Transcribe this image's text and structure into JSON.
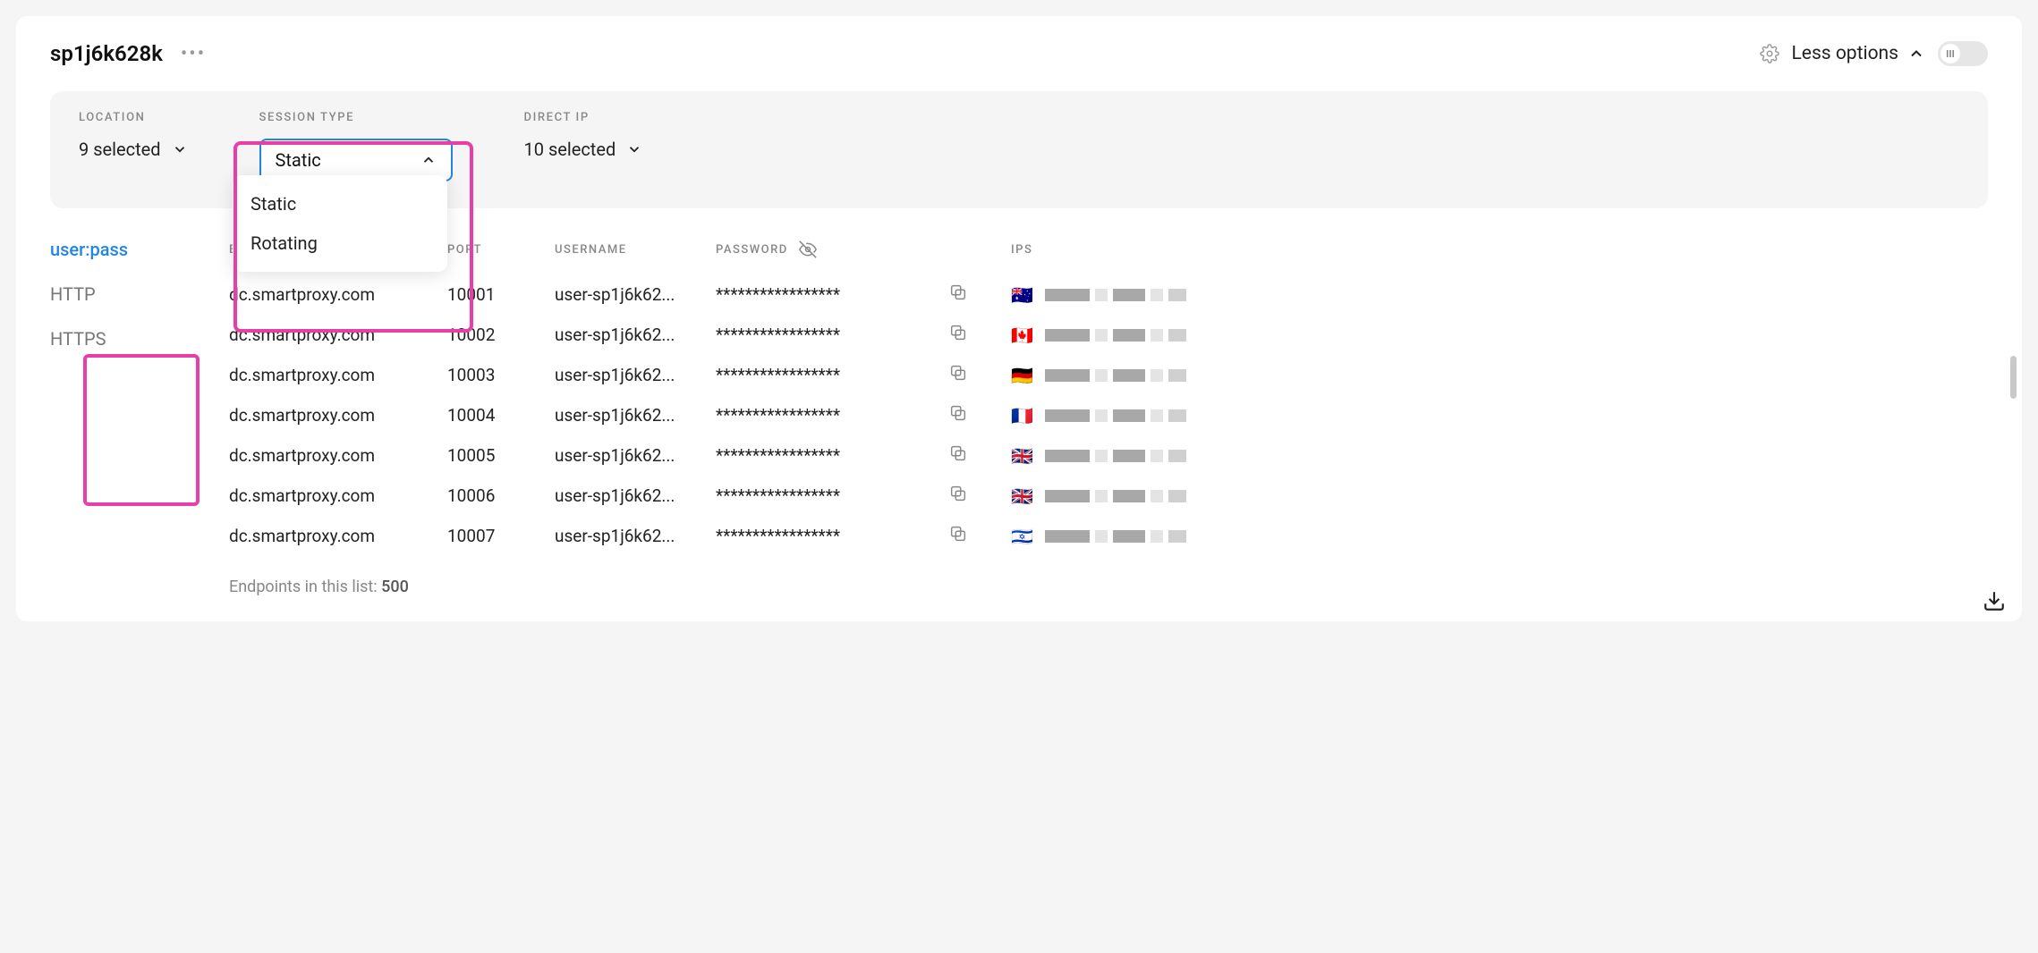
{
  "header": {
    "title": "sp1j6k628k",
    "less_options_label": "Less options"
  },
  "filters": {
    "location": {
      "label": "LOCATION",
      "value": "9 selected"
    },
    "session_type": {
      "label": "SESSION TYPE",
      "value": "Static",
      "options": [
        "Static",
        "Rotating"
      ]
    },
    "direct_ip": {
      "label": "DIRECT IP",
      "value": "10 selected"
    }
  },
  "side_tabs": {
    "userpass": "user:pass",
    "http": "HTTP",
    "https": "HTTPS"
  },
  "table": {
    "headers": {
      "endpoint": "ENDPOINT",
      "port": "PORT",
      "username": "USERNAME",
      "password": "PASSWORD",
      "ips": "IPS"
    },
    "rows": [
      {
        "endpoint": "dc.smartproxy.com",
        "port": "10001",
        "username": "user-sp1j6k62...",
        "password": "*****************",
        "flag": "🇦🇺"
      },
      {
        "endpoint": "dc.smartproxy.com",
        "port": "10002",
        "username": "user-sp1j6k62...",
        "password": "*****************",
        "flag": "🇨🇦"
      },
      {
        "endpoint": "dc.smartproxy.com",
        "port": "10003",
        "username": "user-sp1j6k62...",
        "password": "*****************",
        "flag": "🇩🇪"
      },
      {
        "endpoint": "dc.smartproxy.com",
        "port": "10004",
        "username": "user-sp1j6k62...",
        "password": "*****************",
        "flag": "🇫🇷"
      },
      {
        "endpoint": "dc.smartproxy.com",
        "port": "10005",
        "username": "user-sp1j6k62...",
        "password": "*****************",
        "flag": "🇬🇧"
      },
      {
        "endpoint": "dc.smartproxy.com",
        "port": "10006",
        "username": "user-sp1j6k62...",
        "password": "*****************",
        "flag": "🇬🇧"
      },
      {
        "endpoint": "dc.smartproxy.com",
        "port": "10007",
        "username": "user-sp1j6k62...",
        "password": "*****************",
        "flag": "🇮🇱"
      }
    ]
  },
  "footer": {
    "prefix": "Endpoints in this list: ",
    "count": "500"
  }
}
